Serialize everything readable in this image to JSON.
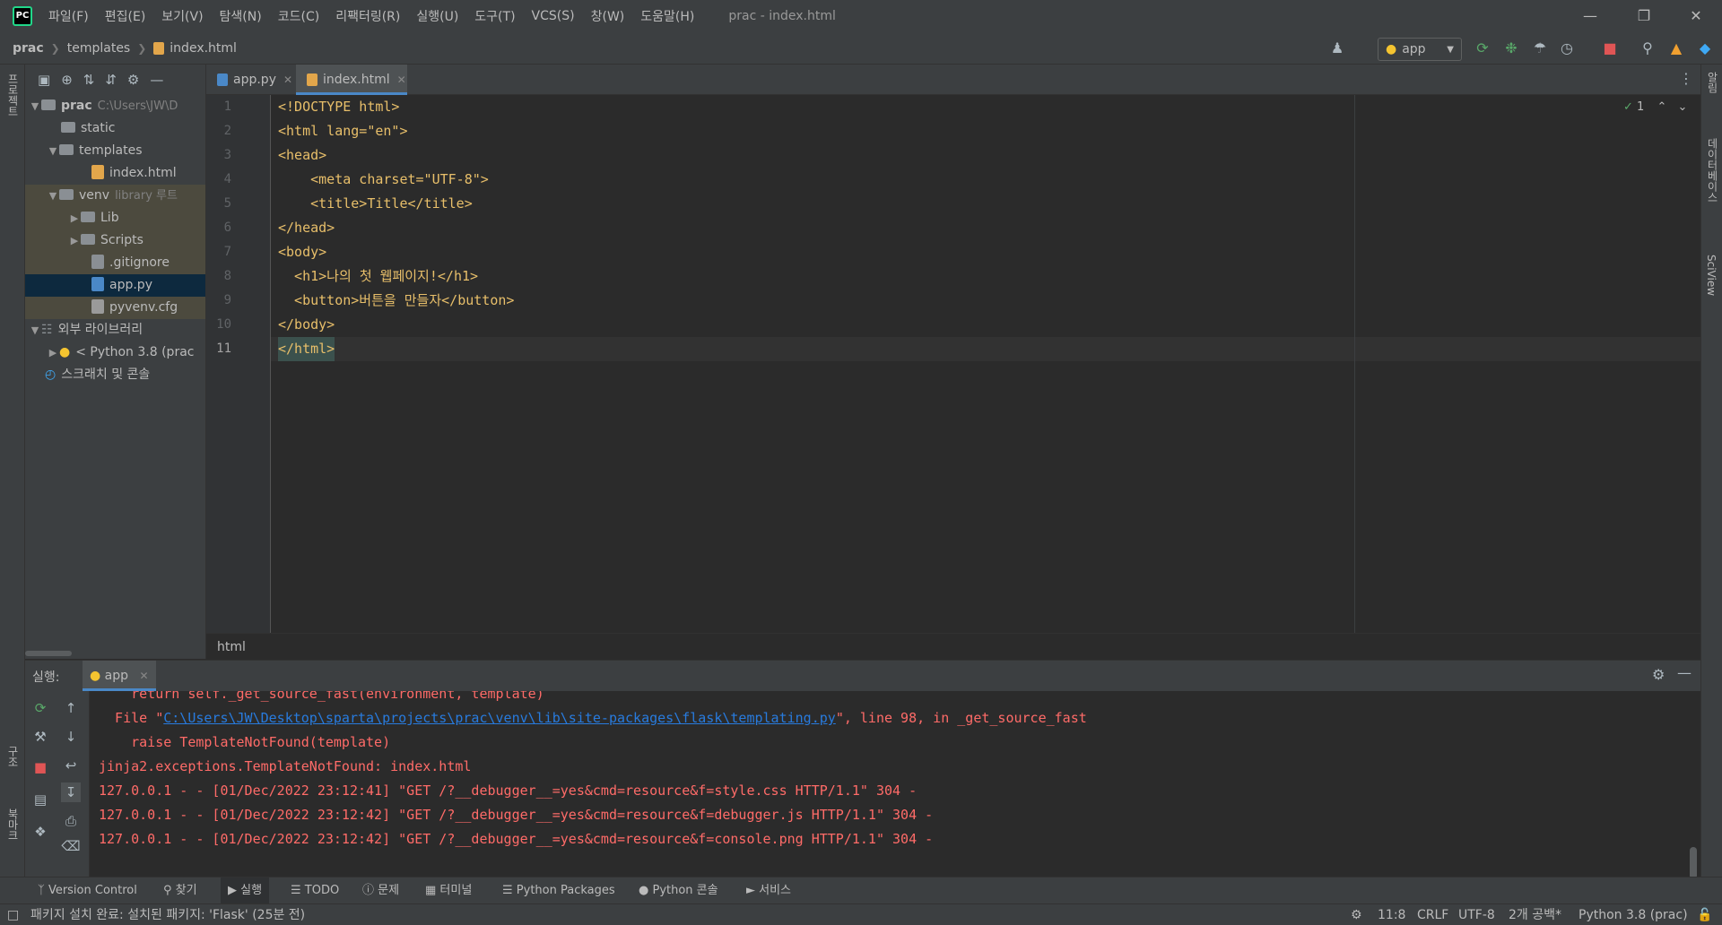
{
  "titlebar": {
    "menus": [
      "파일(F)",
      "편집(E)",
      "보기(V)",
      "탐색(N)",
      "코드(C)",
      "리팩터링(R)",
      "실행(U)",
      "도구(T)",
      "VCS(S)",
      "창(W)",
      "도움말(H)"
    ],
    "window_title": "prac - index.html",
    "logo_text": "PC"
  },
  "navbar": {
    "breadcrumb": [
      "prac",
      "templates",
      "index.html"
    ],
    "run_config": "app"
  },
  "left_strip": {
    "project_label": "프로젝트",
    "structure_label": "구조",
    "bookmarks_label": "북마크"
  },
  "right_strip": {
    "notifications_label": "알림",
    "database_label": "데이터베이스",
    "sciview_label": "SciView"
  },
  "project_tree": [
    {
      "label": "prac",
      "extra": "C:\\Users\\JW\\D",
      "type": "folder",
      "expanded": true
    },
    {
      "label": "static",
      "type": "folder"
    },
    {
      "label": "templates",
      "type": "folder",
      "expanded": true
    },
    {
      "label": "index.html",
      "type": "html"
    },
    {
      "label": "venv",
      "extra": "library 루트",
      "type": "folder",
      "expanded": true
    },
    {
      "label": "Lib",
      "type": "folder"
    },
    {
      "label": "Scripts",
      "type": "folder"
    },
    {
      "label": ".gitignore",
      "type": "file"
    },
    {
      "label": "app.py",
      "type": "python"
    },
    {
      "label": "pyvenv.cfg",
      "type": "file"
    },
    {
      "label": "외부 라이브러리",
      "type": "lib",
      "expanded": true
    },
    {
      "label": "< Python 3.8 (prac",
      "type": "python"
    },
    {
      "label": "스크래치 및 콘솔",
      "type": "scratch"
    }
  ],
  "tabs": [
    {
      "label": "app.py",
      "active": false
    },
    {
      "label": "index.html",
      "active": true
    }
  ],
  "editor": {
    "line_numbers": [
      "1",
      "2",
      "3",
      "4",
      "5",
      "6",
      "7",
      "8",
      "9",
      "10",
      "11"
    ],
    "lines": [
      "<!DOCTYPE html>",
      "<html lang=\"en\">",
      "<head>",
      "    <meta charset=\"UTF-8\">",
      "    <title>Title</title>",
      "</head>",
      "<body>",
      "  <h1>나의 첫 웹페이지!</h1>",
      "  <button>버튼을 만들자</button>",
      "</body>",
      "</html>"
    ],
    "inspection_count": "1",
    "bottom_crumb": "html"
  },
  "run_panel": {
    "label": "실행:",
    "tab": "app",
    "console_lines": [
      {
        "text": "    return self._get_source_fast(environment, template)",
        "kind": "err"
      },
      {
        "text_prefix": "  File \"",
        "link": "C:\\Users\\JW\\Desktop\\sparta\\projects\\prac\\venv\\lib\\site-packages\\flask\\templating.py",
        "text_suffix": "\", line 98, in _get_source_fast",
        "kind": "err"
      },
      {
        "text": "    raise TemplateNotFound(template)",
        "kind": "err"
      },
      {
        "text": "jinja2.exceptions.TemplateNotFound: index.html",
        "kind": "err"
      },
      {
        "text": "127.0.0.1 - - [01/Dec/2022 23:12:41] \"GET /?__debugger__=yes&cmd=resource&f=style.css HTTP/1.1\" 304 -",
        "kind": "err"
      },
      {
        "text": "127.0.0.1 - - [01/Dec/2022 23:12:42] \"GET /?__debugger__=yes&cmd=resource&f=debugger.js HTTP/1.1\" 304 -",
        "kind": "err"
      },
      {
        "text": "127.0.0.1 - - [01/Dec/2022 23:12:42] \"GET /?__debugger__=yes&cmd=resource&f=console.png HTTP/1.1\" 304 -",
        "kind": "err"
      }
    ]
  },
  "tool_windows": [
    "Version Control",
    "찾기",
    "실행",
    "TODO",
    "문제",
    "터미널",
    "Python Packages",
    "Python 콘솔",
    "서비스"
  ],
  "statusbar": {
    "message": "패키지 설치 완료: 설치된 패키지: 'Flask' (25분 전)",
    "position": "11:8",
    "line_sep": "CRLF",
    "encoding": "UTF-8",
    "indent": "2개 공백*",
    "interpreter": "Python 3.8 (prac)"
  },
  "colors": {
    "accent": "#4a88c7",
    "error": "#ff6b68",
    "tag": "#e8bf6a",
    "string": "#6a8759",
    "link": "#287bde"
  }
}
